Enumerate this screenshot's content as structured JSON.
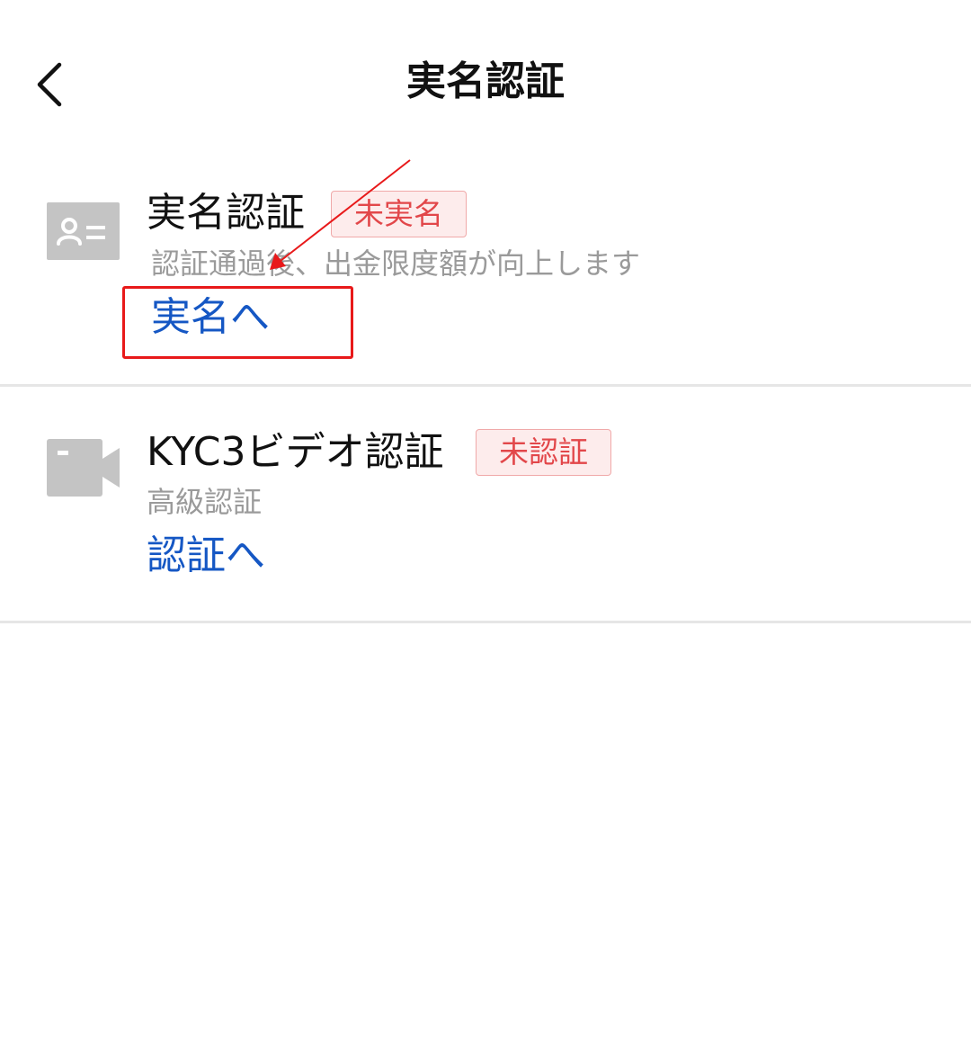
{
  "header": {
    "title": "実名認証",
    "back_icon": "chevron-left-icon"
  },
  "items": [
    {
      "icon": "id-card-icon",
      "title": "実名認証",
      "badge": "未実名",
      "subtitle": "認証通過後、出金限度額が向上します",
      "action": "実名へ"
    },
    {
      "icon": "video-camera-icon",
      "title": "KYC3ビデオ認証",
      "badge": "未認証",
      "subtitle": "高級認証",
      "action": "認証へ"
    }
  ],
  "colors": {
    "badge_text": "#e2474a",
    "badge_bg": "#fdecec",
    "badge_border": "#f0a9a9",
    "action_text": "#1557c4",
    "icon_gray": "#c4c4c4",
    "annotation_red": "#e8191a"
  }
}
